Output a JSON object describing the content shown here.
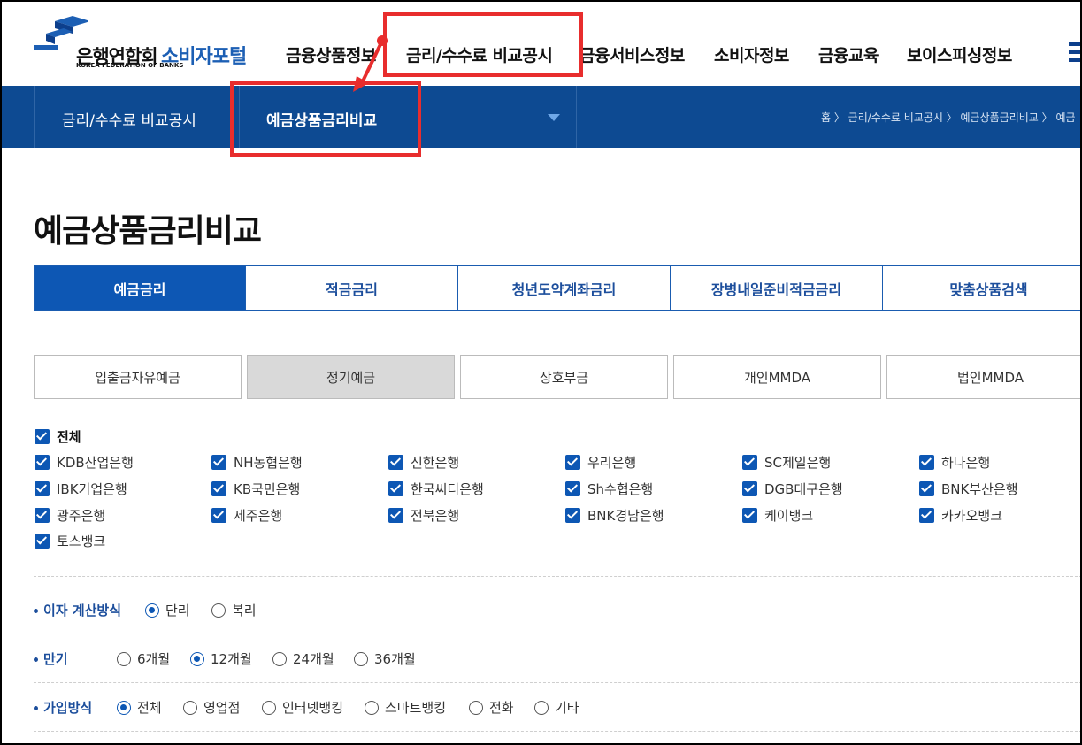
{
  "logo": {
    "korean": "은행연합회",
    "english": "KOREA FEDERATION OF BANKS",
    "portal": "소비자포털"
  },
  "gnb": [
    "금융상품정보",
    "금리/수수료 비교공시",
    "금융서비스정보",
    "소비자정보",
    "금융교육",
    "보이스피싱정보"
  ],
  "subnav": {
    "level1": "금리/수수료 비교공시",
    "level2": "예금상품금리비교"
  },
  "breadcrumb": "홈  〉 금리/수수료 비교공시  〉 예금상품금리비교  〉 예금",
  "page_title": "예금상품금리비교",
  "tabs": [
    "예금금리",
    "적금금리",
    "청년도약계좌금리",
    "장병내일준비적금금리",
    "맞춤상품검색"
  ],
  "subtabs": [
    "입출금자유예금",
    "정기예금",
    "상호부금",
    "개인MMDA",
    "법인MMDA"
  ],
  "banks_all": "전체",
  "banks": [
    [
      "KDB산업은행",
      "NH농협은행",
      "신한은행",
      "우리은행",
      "SC제일은행",
      "하나은행"
    ],
    [
      "IBK기업은행",
      "KB국민은행",
      "한국씨티은행",
      "Sh수협은행",
      "DGB대구은행",
      "BNK부산은행"
    ],
    [
      "광주은행",
      "제주은행",
      "전북은행",
      "BNK경남은행",
      "케이뱅크",
      "카카오뱅크"
    ],
    [
      "토스뱅크"
    ]
  ],
  "interest_calc": {
    "label": "이자 계산방식",
    "options": [
      "단리",
      "복리"
    ],
    "selected": "단리"
  },
  "term": {
    "label": "만기",
    "options": [
      "6개월",
      "12개월",
      "24개월",
      "36개월"
    ],
    "selected": "12개월"
  },
  "join_method": {
    "label": "가입방식",
    "options": [
      "전체",
      "영업점",
      "인터넷뱅킹",
      "스마트뱅킹",
      "전화",
      "기타"
    ],
    "selected": "전체"
  },
  "colors": {
    "navy": "#0d4a92",
    "accent": "#0d57b4",
    "annotation": "#e82d2d"
  }
}
